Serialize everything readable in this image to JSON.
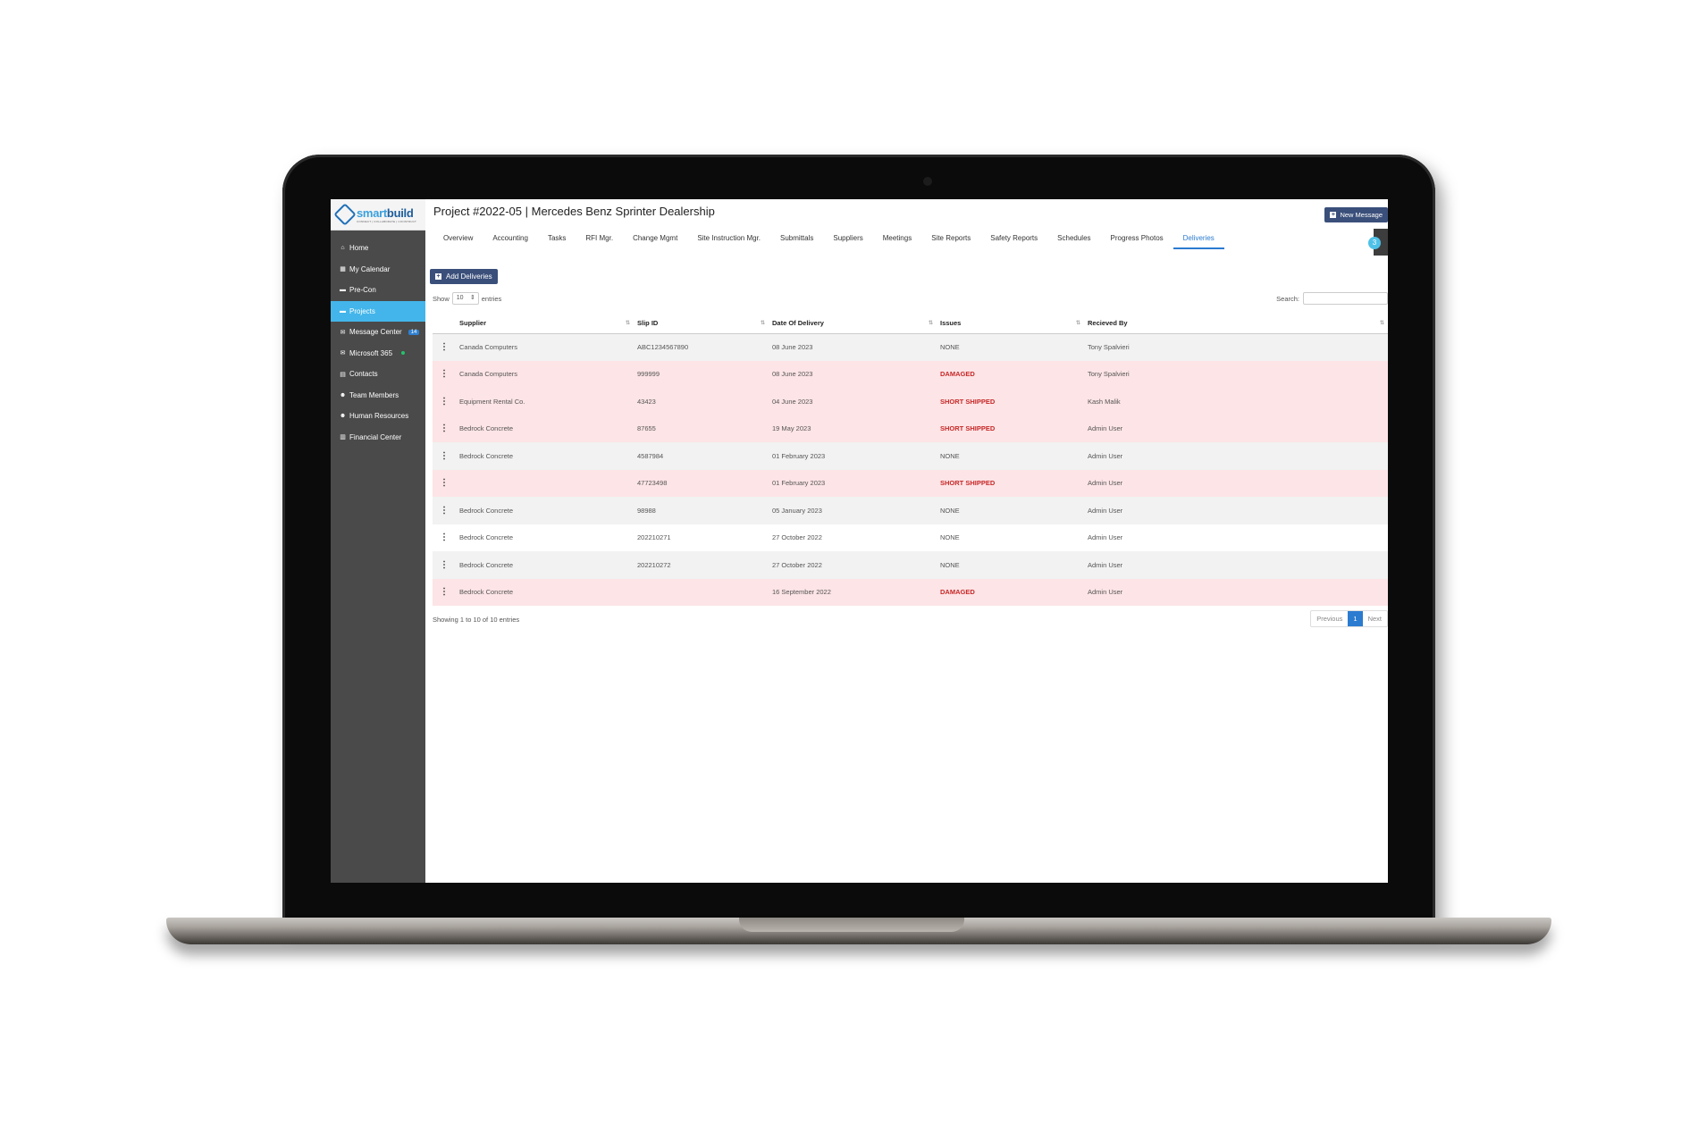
{
  "app": {
    "logo_name_a": "smart",
    "logo_name_b": "build",
    "logo_tagline": "CONNECT | COLLABORATE | CONSTRUCT"
  },
  "sidebar": {
    "items": [
      {
        "label": "Home",
        "icon": "home-icon"
      },
      {
        "label": "My Calendar",
        "icon": "calendar-icon"
      },
      {
        "label": "Pre-Con",
        "icon": "folder-icon"
      },
      {
        "label": "Projects",
        "icon": "folder-icon"
      },
      {
        "label": "Message Center",
        "icon": "envelope-icon",
        "badge": "14"
      },
      {
        "label": "Microsoft 365",
        "icon": "envelope-icon"
      },
      {
        "label": "Contacts",
        "icon": "contacts-icon"
      },
      {
        "label": "Team Members",
        "icon": "users-icon"
      },
      {
        "label": "Human Resources",
        "icon": "users-icon"
      },
      {
        "label": "Financial Center",
        "icon": "document-icon"
      }
    ]
  },
  "header": {
    "title": "Project #2022-05 | Mercedes Benz Sprinter Dealership",
    "new_message_label": "New Message",
    "help_label": "3"
  },
  "tabs": [
    "Overview",
    "Accounting",
    "Tasks",
    "RFI Mgr.",
    "Change Mgmt",
    "Site Instruction Mgr.",
    "Submittals",
    "Suppliers",
    "Meetings",
    "Site Reports",
    "Safety Reports",
    "Schedules",
    "Progress Photos",
    "Deliveries"
  ],
  "toolbar": {
    "add_label": "Add Deliveries",
    "show_label": "Show",
    "entries_label": "entries",
    "page_size": "10",
    "search_label": "Search:"
  },
  "table": {
    "columns": [
      "Supplier",
      "Slip ID",
      "Date Of Delivery",
      "Issues",
      "Recieved By"
    ],
    "rows": [
      {
        "supplier": "Canada Computers",
        "slip": "ABC1234567890",
        "date": "08 June 2023",
        "issues": "NONE",
        "received": "Tony Spalvieri",
        "style": "grey"
      },
      {
        "supplier": "Canada Computers",
        "slip": "999999",
        "date": "08 June 2023",
        "issues": "DAMAGED",
        "received": "Tony Spalvieri",
        "style": "pink"
      },
      {
        "supplier": "Equipment Rental Co.",
        "slip": "43423",
        "date": "04 June 2023",
        "issues": "SHORT SHIPPED",
        "received": "Kash Malik",
        "style": "pink"
      },
      {
        "supplier": "Bedrock Concrete",
        "slip": "87655",
        "date": "19 May 2023",
        "issues": "SHORT SHIPPED",
        "received": "Admin User",
        "style": "pink"
      },
      {
        "supplier": "Bedrock Concrete",
        "slip": "4587984",
        "date": "01 February 2023",
        "issues": "NONE",
        "received": "Admin User",
        "style": "grey"
      },
      {
        "supplier": "",
        "slip": "47723498",
        "date": "01 February 2023",
        "issues": "SHORT SHIPPED",
        "received": "Admin User",
        "style": "pink"
      },
      {
        "supplier": "Bedrock Concrete",
        "slip": "98988",
        "date": "05 January 2023",
        "issues": "NONE",
        "received": "Admin User",
        "style": "grey"
      },
      {
        "supplier": "Bedrock Concrete",
        "slip": "202210271",
        "date": "27 October 2022",
        "issues": "NONE",
        "received": "Admin User",
        "style": "white"
      },
      {
        "supplier": "Bedrock Concrete",
        "slip": "202210272",
        "date": "27 October 2022",
        "issues": "NONE",
        "received": "Admin User",
        "style": "grey"
      },
      {
        "supplier": "Bedrock Concrete",
        "slip": "",
        "date": "16 September 2022",
        "issues": "DAMAGED",
        "received": "Admin User",
        "style": "pink"
      }
    ]
  },
  "footer": {
    "info": "Showing 1 to 10 of 10 entries",
    "previous": "Previous",
    "current_page": "1",
    "next": "Next"
  },
  "colors": {
    "accent": "#43b5ea",
    "button": "#3a4f7a",
    "issue_bad": "#c62828",
    "row_pink": "#fde4e6"
  }
}
